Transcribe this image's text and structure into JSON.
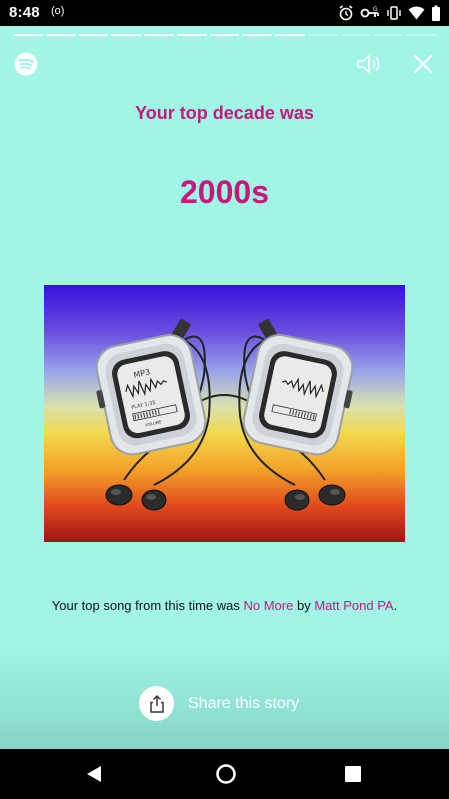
{
  "status_bar": {
    "time": "8:48",
    "radio_icon": "(o)",
    "icons": [
      "alarm-icon",
      "vpn-key-icon",
      "vibrate-icon",
      "wifi-icon",
      "battery-icon"
    ]
  },
  "story": {
    "progress": {
      "total_segments": 13,
      "completed_segments": 9
    },
    "heading": "Your top decade was",
    "decade": "2000s",
    "top_song": {
      "prefix": "Your top song from this time was ",
      "song": "No More",
      "by": " by ",
      "artist": "Matt Pond PA",
      "suffix": "."
    },
    "share_label": "Share this story",
    "device_labels": {
      "screen_title": "MP3",
      "play": "PLAY 1:35",
      "volume": "VOLUME"
    }
  },
  "colors": {
    "background": "#a0f5e6",
    "accent": "#c8197a",
    "progress_active": "#ffffff"
  },
  "icons": {
    "logo": "spotify-logo-icon",
    "sound": "speaker-icon",
    "close": "close-icon",
    "share": "share-icon",
    "nav": [
      "back-icon",
      "home-icon",
      "recents-icon"
    ]
  }
}
